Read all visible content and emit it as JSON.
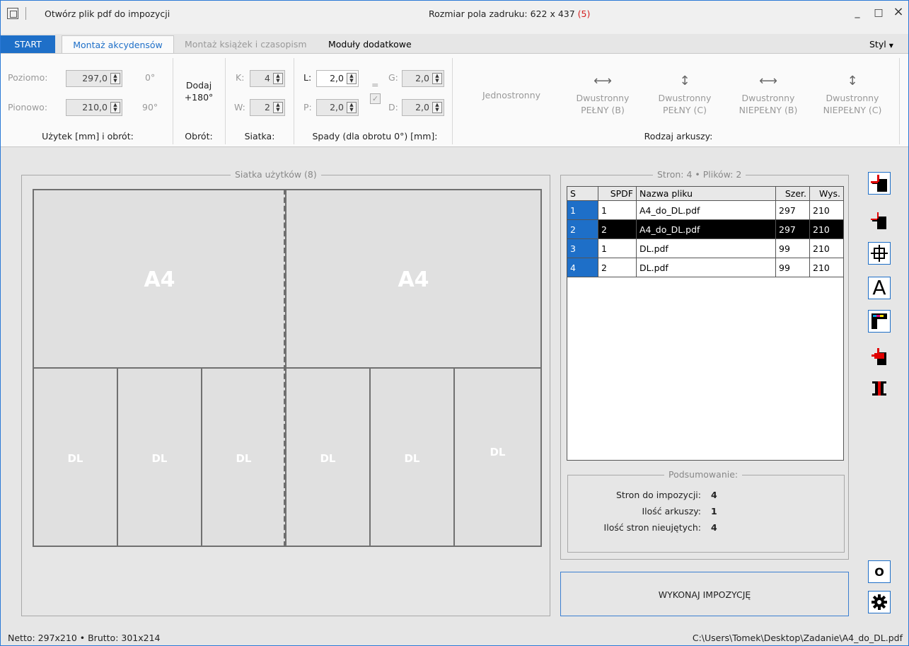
{
  "window": {
    "title": "Otwórz plik pdf do impozycji",
    "center_prefix": "Rozmiar  pola zadruku: 622 x 437",
    "center_suffix": "(5)",
    "minimize": "_",
    "maximize": "□",
    "close": "×"
  },
  "tabs": {
    "start": "START",
    "active": "Montaż akcydensów",
    "books": "Montaż książek i czasopism",
    "modules": "Moduły dodatkowe",
    "style": "Styl"
  },
  "ribbon": {
    "size": {
      "horizontal_label": "Poziomo:",
      "horizontal_value": "297,0",
      "vertical_label": "Pionowo:",
      "vertical_value": "210,0",
      "deg0": "0°",
      "deg90": "90°",
      "group_label": "Użytek [mm] i obrót:"
    },
    "rotation": {
      "line1": "Dodaj",
      "line2": "+180°",
      "group_label": "Obrót:"
    },
    "grid": {
      "k_label": "K:",
      "k_value": "4",
      "w_label": "W:",
      "w_value": "2",
      "group_label": "Siatka:"
    },
    "bleed": {
      "l_label": "L:",
      "l_value": "2,0",
      "p_label": "P:",
      "p_value": "2,0",
      "g_label": "G:",
      "g_value": "2,0",
      "d_label": "D:",
      "d_value": "2,0",
      "eq": "=",
      "check": "✓",
      "group_label": "Spady (dla obrotu 0°) [mm]:"
    },
    "sheet_type": {
      "one_sided": "Jednostronny",
      "b1_line1": "Dwustronny",
      "b1_line2": "PEŁNY (B)",
      "b2_line1": "Dwustronny",
      "b2_line2": "PEŁNY (C)",
      "b3_line1": "Dwustronny",
      "b3_line2": "NIEPEŁNY (B)",
      "b4_line1": "Dwustronny",
      "b4_line2": "NIEPEŁNY (C)",
      "group_label": "Rodzaj arkuszy:"
    }
  },
  "grid_panel": {
    "title": "Siatka użytków (8)",
    "big_cells": [
      "A4",
      "A4"
    ],
    "small_cells": [
      "DL",
      "DL",
      "DL",
      "DL",
      "DL",
      "DL"
    ]
  },
  "pages_panel": {
    "title": "Stron: 4 • Plików: 2",
    "headers": [
      "S",
      "SPDF",
      "Nazwa pliku",
      "Szer.",
      "Wys."
    ],
    "rows": [
      [
        "1",
        "1",
        "A4_do_DL.pdf",
        "297",
        "210"
      ],
      [
        "2",
        "2",
        "A4_do_DL.pdf",
        "297",
        "210"
      ],
      [
        "3",
        "1",
        "DL.pdf",
        "99",
        "210"
      ],
      [
        "4",
        "2",
        "DL.pdf",
        "99",
        "210"
      ]
    ],
    "selected_row": 1
  },
  "summary": {
    "title": "Podsumowanie:",
    "pages_label": "Stron do impozycji:",
    "pages_value": "4",
    "sheets_label": "Ilość arkuszy:",
    "sheets_value": "1",
    "unused_label": "Ilość stron nieujętych:",
    "unused_value": "4"
  },
  "execute_button": "WYKONAJ IMPOZYCJĘ",
  "side_tools": {
    "o_label": "O",
    "a_label": "A"
  },
  "status": {
    "left": "Netto: 297x210 • Brutto: 301x214",
    "right": "C:\\Users\\Tomek\\Desktop\\Zadanie\\A4_do_DL.pdf"
  },
  "colors": {
    "accent": "#1e6fc8",
    "red": "#e00000"
  }
}
